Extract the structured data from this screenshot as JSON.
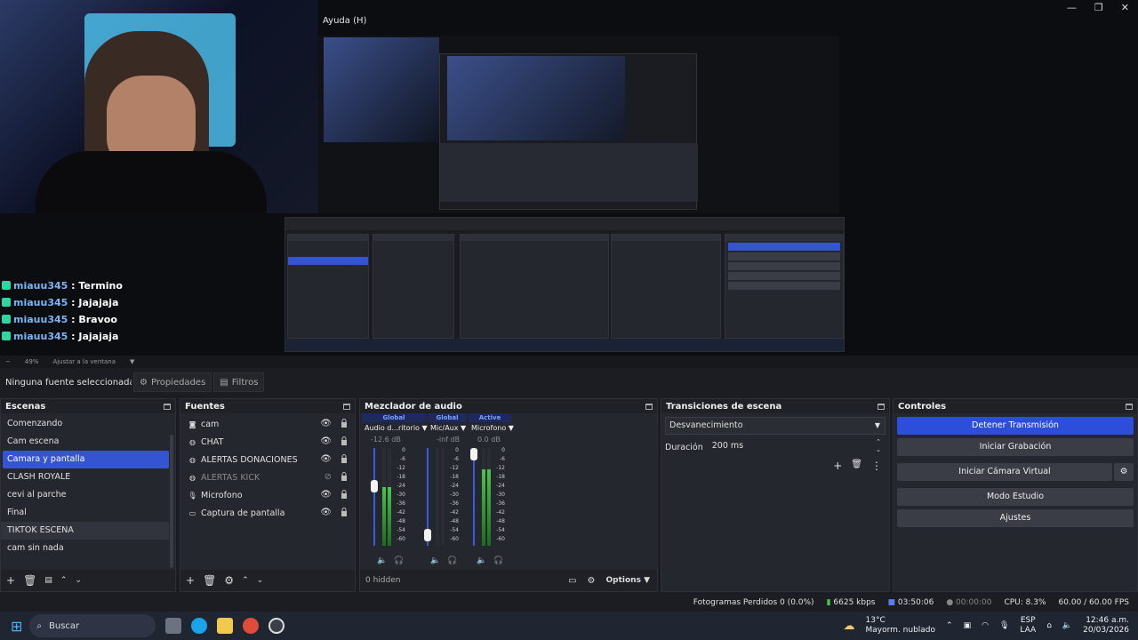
{
  "window": {
    "menu_help": "Ayuda (H)",
    "controls": [
      "—",
      "❐",
      "✕"
    ]
  },
  "chat": [
    {
      "user": "miauu345",
      "text": ": Termino"
    },
    {
      "user": "miauu345",
      "text": ": Jajajaja"
    },
    {
      "user": "miauu345",
      "text": ": Bravoo"
    },
    {
      "user": "miauu345",
      "text": ": Jajajaja"
    }
  ],
  "zoombar": {
    "minus": "−",
    "zoom": "49%",
    "fit": "Ajustar a la ventana"
  },
  "propbar": {
    "no_source": "Ninguna fuente seleccionada",
    "properties": "Propiedades",
    "filters": "Filtros"
  },
  "scenes": {
    "title": "Escenas",
    "items": [
      "Comenzando",
      "Cam escena",
      "Camara y pantalla",
      "CLASH ROYALE",
      "cevi al parche",
      "Final",
      "TIKTOK ESCENA",
      "cam sin nada"
    ],
    "selected": "Camara y pantalla"
  },
  "sources": {
    "title": "Fuentes",
    "items": [
      {
        "label": "cam",
        "icon": "camera-icon",
        "visible": true
      },
      {
        "label": "CHAT",
        "icon": "globe-icon",
        "visible": true
      },
      {
        "label": "ALERTAS DONACIONES",
        "icon": "globe-icon",
        "visible": true
      },
      {
        "label": "ALERTAS KICK",
        "icon": "globe-icon",
        "visible": false
      },
      {
        "label": "Microfono",
        "icon": "microphone-icon",
        "visible": true
      },
      {
        "label": "Captura de pantalla",
        "icon": "monitor-icon",
        "visible": true
      }
    ]
  },
  "mixer": {
    "title": "Mezclador de audio",
    "channels": [
      {
        "head": "Global",
        "name": "Audio d...ritorio",
        "db": "-12.6 dB",
        "level": 0.62
      },
      {
        "head": "Global",
        "name": "Mic/Aux",
        "db": "-inf dB",
        "level": 0.05
      },
      {
        "head": "Active",
        "name": "Microfono",
        "db": "0.0 dB",
        "level": 1.0
      }
    ],
    "scale": [
      "0",
      "-6",
      "-12",
      "-18",
      "-24",
      "-30",
      "-36",
      "-42",
      "-48",
      "-54",
      "-60"
    ],
    "hidden": "0 hidden",
    "options": "Options"
  },
  "transitions": {
    "title": "Transiciones de escena",
    "type": "Desvanecimiento",
    "duration_label": "Duración",
    "duration": "200 ms"
  },
  "controls": {
    "title": "Controles",
    "stop_stream": "Detener Transmisión",
    "start_rec": "Iniciar Grabación",
    "virtual_cam": "Iniciar Cámara Virtual",
    "studio": "Modo Estudio",
    "settings": "Ajustes"
  },
  "status": {
    "dropped": "Fotogramas Perdidos 0 (0.0%)",
    "bitrate": "6625 kbps",
    "stream_time": "03:50:06",
    "rec_time": "00:00:00",
    "cpu": "CPU: 8.3%",
    "fps": "60.00 / 60.00 FPS"
  },
  "taskbar": {
    "search": "Buscar",
    "weather_temp": "13°C",
    "weather_desc": "Mayorm. nublado",
    "lang1": "ESP",
    "lang2": "LAA",
    "time": "12:46 a.m.",
    "date": "20/03/2026"
  },
  "colors": {
    "accent": "#3454d1",
    "bg": "#25272e",
    "meter_green": "#4cc34c"
  }
}
